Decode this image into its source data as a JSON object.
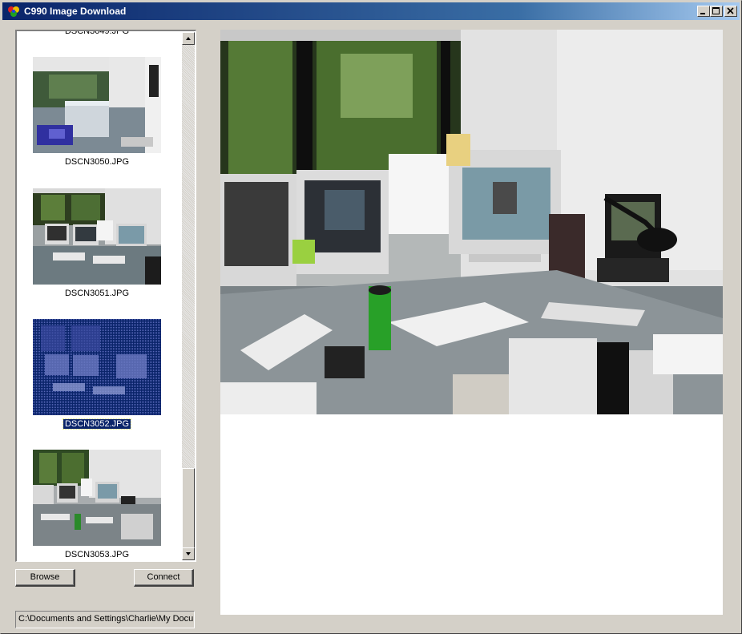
{
  "window": {
    "title": "C990 Image Download",
    "colors": {
      "titlebar_start": "#0a246a",
      "titlebar_end": "#a6caf0",
      "face": "#d4d0c8",
      "selection": "#0a246a"
    }
  },
  "thumbnails": {
    "partial_top_label": "DSCN3049.JPG",
    "items": [
      {
        "filename": "DSCN3050.JPG",
        "selected": false
      },
      {
        "filename": "DSCN3051.JPG",
        "selected": false
      },
      {
        "filename": "DSCN3052.JPG",
        "selected": true
      },
      {
        "filename": "DSCN3053.JPG",
        "selected": false
      }
    ]
  },
  "buttons": {
    "browse": "Browse",
    "connect": "Connect"
  },
  "path_field": {
    "value": "C:\\Documents and Settings\\Charlie\\My Docu"
  },
  "icons": {
    "app": "app-logo-icon",
    "minimize": "minimize-icon",
    "maximize": "maximize-icon",
    "close": "close-icon",
    "scroll_up": "scroll-up-arrow-icon",
    "scroll_down": "scroll-down-arrow-icon"
  }
}
